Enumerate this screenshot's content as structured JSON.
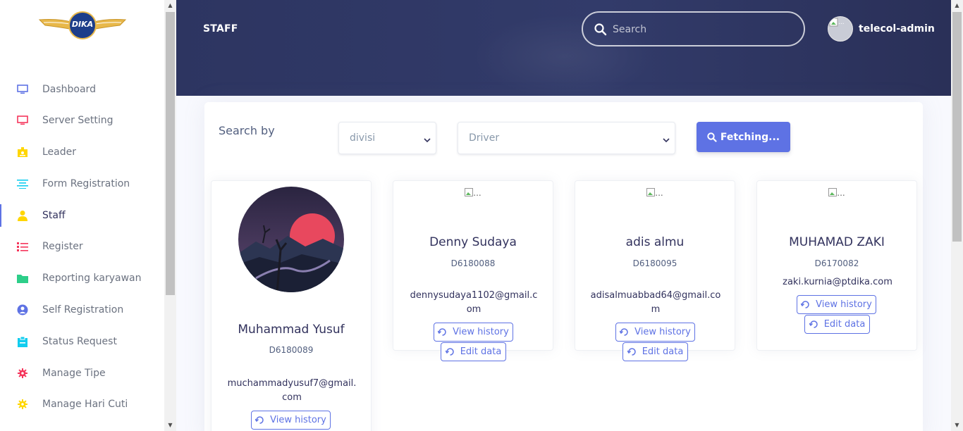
{
  "sidebar": {
    "logo_text": "DIKA",
    "items": [
      {
        "label": "Dashboard",
        "icon": "monitor-icon",
        "color": "#5e72e4"
      },
      {
        "label": "Server Setting",
        "icon": "monitor-icon",
        "color": "#f5365c"
      },
      {
        "label": "Leader",
        "icon": "badge-icon",
        "color": "#ffd600"
      },
      {
        "label": "Form Registration",
        "icon": "align-center-icon",
        "color": "#11cdef"
      },
      {
        "label": "Staff",
        "icon": "single-user-icon",
        "color": "#ffd600"
      },
      {
        "label": "Register",
        "icon": "bullet-list-icon",
        "color": "#f5365c"
      },
      {
        "label": "Reporting karyawan",
        "icon": "folder-icon",
        "color": "#2dce89"
      },
      {
        "label": "Self Registration",
        "icon": "user-circle-icon",
        "color": "#5e72e4"
      },
      {
        "label": "Status Request",
        "icon": "clipboard-icon",
        "color": "#11cdef"
      },
      {
        "label": "Manage Tipe",
        "icon": "gear-icon",
        "color": "#f5365c"
      },
      {
        "label": "Manage Hari Cuti",
        "icon": "sun-icon",
        "color": "#ffd600"
      }
    ],
    "active_index": 4
  },
  "header": {
    "title": "STAFF",
    "search_placeholder": "Search",
    "user_name": "telecol-admin",
    "avatar_alt": "..."
  },
  "filter": {
    "label": "Search by",
    "field_select": "divisi",
    "value_select": "Driver",
    "button_label": "Fetching..."
  },
  "staff": [
    {
      "name": "Muhammad Yusuf",
      "code": "D6180089",
      "email": "muchammadyusuf7@gmail.com",
      "photo": "sunset-landscape"
    },
    {
      "name": "Denny Sudaya",
      "code": "D6180088",
      "email": "dennysudaya1102@gmail.com",
      "photo_alt": "..."
    },
    {
      "name": "adis almu",
      "code": "D6180095",
      "email": "adisalmuabbad64@gmail.com",
      "photo_alt": "..."
    },
    {
      "name": "MUHAMAD ZAKI",
      "code": "D6170082",
      "email": "zaki.kurnia@ptdika.com",
      "photo_alt": "..."
    }
  ],
  "actions": {
    "view_history": "View history",
    "edit_data": "Edit data"
  },
  "colors": {
    "primary": "#5e72e4",
    "header_bg": "#2d3561"
  }
}
